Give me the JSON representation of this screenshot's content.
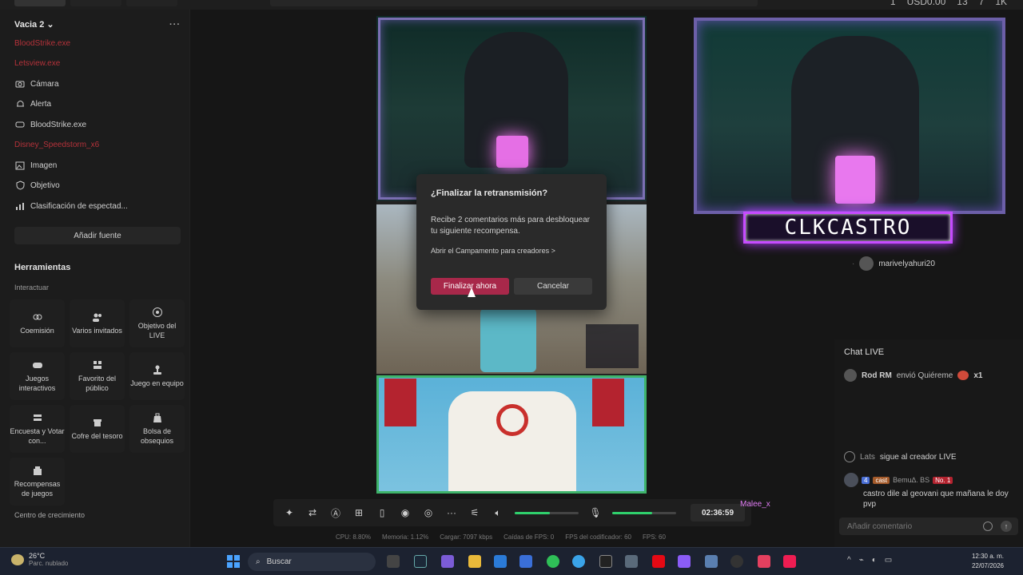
{
  "top_stats": [
    "1",
    "USD0.00",
    "13",
    "7",
    "1K"
  ],
  "scene": {
    "name": "Vacia 2",
    "menu_glyph": "···"
  },
  "sources": [
    {
      "label": "BloodStrike.exe",
      "error": true
    },
    {
      "label": "Letsview.exe",
      "error": true
    },
    {
      "label": "Cámara",
      "error": false,
      "icon": "camera-icon"
    },
    {
      "label": "Alerta",
      "error": false,
      "icon": "bell-icon"
    },
    {
      "label": "BloodStrike.exe",
      "error": false,
      "icon": "gamepad-icon"
    },
    {
      "label": "Disney_Speedstorm_x6",
      "error": true
    },
    {
      "label": "Imagen",
      "error": false,
      "icon": "image-icon"
    },
    {
      "label": "Objetivo",
      "error": false,
      "icon": "shield-icon"
    },
    {
      "label": "Clasificación de espectad...",
      "error": false,
      "icon": "ranking-icon"
    }
  ],
  "add_source_label": "Añadir fuente",
  "tools_title": "Herramientas",
  "interact_title": "Interactuar",
  "tools": [
    {
      "label": "Coemisión",
      "icon": "link-icon"
    },
    {
      "label": "Varios invitados",
      "icon": "guests-icon"
    },
    {
      "label": "Objetivo del LIVE",
      "icon": "target-icon"
    },
    {
      "label": "Juegos interactivos",
      "icon": "gamepad-icon"
    },
    {
      "label": "Favorito del público",
      "icon": "favorite-icon"
    },
    {
      "label": "Juego en equipo",
      "icon": "joystick-icon"
    },
    {
      "label": "Encuesta y Votar con...",
      "icon": "poll-icon"
    },
    {
      "label": "Cofre del tesoro",
      "icon": "chest-icon"
    },
    {
      "label": "Bolsa de obsequios",
      "icon": "gift-bag-icon"
    },
    {
      "label": "Recompensas de juegos",
      "icon": "reward-icon"
    }
  ],
  "growth_title": "Centro de crecimiento",
  "modal": {
    "title": "¿Finalizar la retransmisión?",
    "body": "Recibe 2 comentarios más para desbloquear tu siguiente recompensa.",
    "link": "Abrir el Campamento para creadores >",
    "confirm": "Finalizar ahora",
    "cancel": "Cancelar"
  },
  "nameplate": "CLKCASTRO",
  "viewer_name": "marivelyahuri20",
  "chat": {
    "title": "Chat LIVE",
    "gift": {
      "user": "Rod RM",
      "text": "envió Quiéreme",
      "count": "x1"
    },
    "follow": {
      "user": "Lats",
      "text": "sigue al creador LIVE"
    },
    "message": {
      "level": "4",
      "badge": "cast",
      "user": "Bemu∆. BS",
      "rank": "No. 1",
      "text": "castro dile al geovani que mañana le doy pvp"
    },
    "placeholder": "Añadir comentario"
  },
  "controls": {
    "timer": "02:36:59",
    "volume_level": 0.55,
    "mic_level": 0.62
  },
  "overlay_name": "Malee_x",
  "stats": [
    "CPU: 8.80%",
    "Memoria: 1.12%",
    "Cargar: 7097 kbps",
    "Caídas de FPS: 0",
    "FPS del codificador: 60",
    "FPS: 60"
  ],
  "taskbar": {
    "temp": "26°C",
    "weather": "Parc. nublado",
    "search": "Buscar",
    "time": "12:30 a. m.",
    "date": "22/07/2026"
  },
  "colors": {
    "accent_red": "#a8284a",
    "error_red": "#b5323a",
    "slider_green": "#2fd06c",
    "neon_purple": "#c64bff"
  }
}
